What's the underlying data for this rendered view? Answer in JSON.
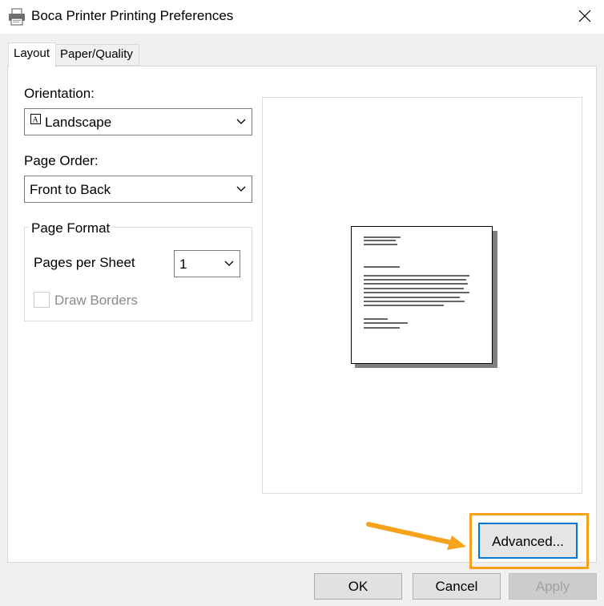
{
  "window": {
    "title": "Boca Printer Printing Preferences",
    "icon": "printer-icon",
    "close_icon": "close-icon"
  },
  "tabs": [
    {
      "label": "Layout",
      "active": true
    },
    {
      "label": "Paper/Quality",
      "active": false
    }
  ],
  "orientation": {
    "label": "Orientation:",
    "value": "Landscape",
    "icon": "landscape-page-icon"
  },
  "page_order": {
    "label": "Page Order:",
    "value": "Front to Back"
  },
  "page_format": {
    "title": "Page Format",
    "pages_per_sheet_label": "Pages per Sheet",
    "pages_per_sheet_value": "1",
    "draw_borders_label": "Draw Borders",
    "draw_borders_checked": false,
    "draw_borders_enabled": false
  },
  "buttons": {
    "advanced": "Advanced...",
    "ok": "OK",
    "cancel": "Cancel",
    "apply": "Apply"
  },
  "colors": {
    "highlight": "#f7a21b",
    "focus": "#0078d7",
    "panel": "#ffffff",
    "dialog": "#f0f0f0"
  }
}
